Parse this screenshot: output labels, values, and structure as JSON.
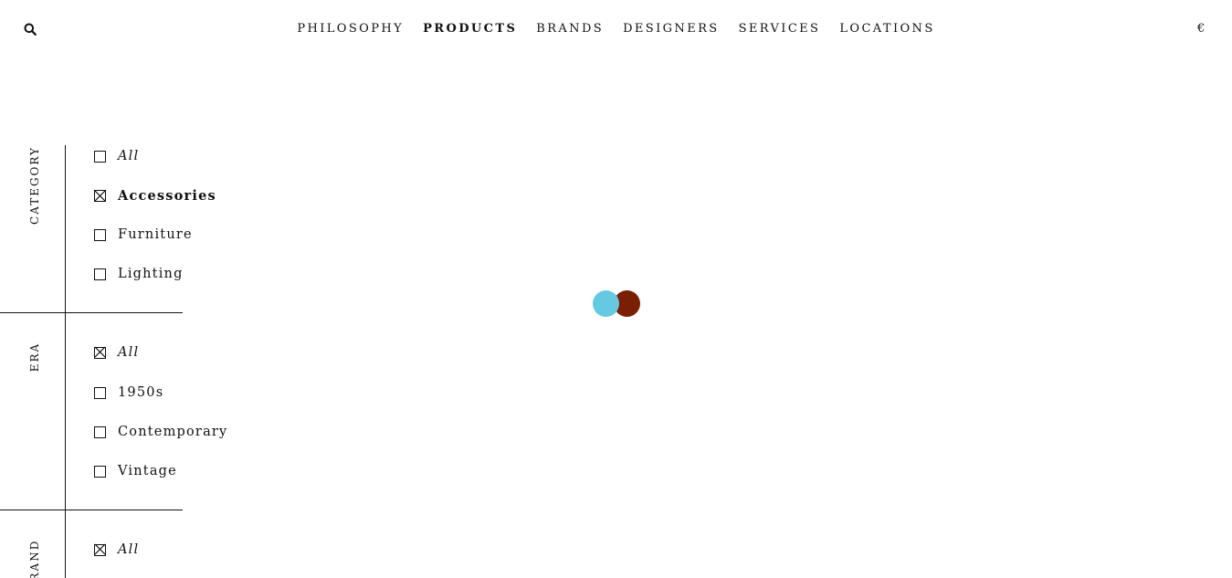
{
  "nav": {
    "items": [
      {
        "label": "PHILOSOPHY",
        "active": false
      },
      {
        "label": "PRODUCTS",
        "active": true
      },
      {
        "label": "BRANDS",
        "active": false
      },
      {
        "label": "DESIGNERS",
        "active": false
      },
      {
        "label": "SERVICES",
        "active": false
      },
      {
        "label": "LOCATIONS",
        "active": false
      }
    ],
    "currency": "€",
    "search_icon": "search-icon"
  },
  "filters": {
    "category": {
      "label": "CATEGORY",
      "options": [
        {
          "label": "All",
          "checked": false
        },
        {
          "label": "Accessories",
          "checked": true
        },
        {
          "label": "Furniture",
          "checked": false
        },
        {
          "label": "Lighting",
          "checked": false
        }
      ]
    },
    "era": {
      "label": "ERA",
      "options": [
        {
          "label": "All",
          "checked": true
        },
        {
          "label": "1950s",
          "checked": false
        },
        {
          "label": "Contemporary",
          "checked": false
        },
        {
          "label": "Vintage",
          "checked": false
        }
      ]
    },
    "brand": {
      "label": "BRAND",
      "options": [
        {
          "label": "All",
          "checked": true
        }
      ]
    }
  },
  "loader": {
    "colors": [
      "#65c9e2",
      "#7a1e04"
    ]
  }
}
